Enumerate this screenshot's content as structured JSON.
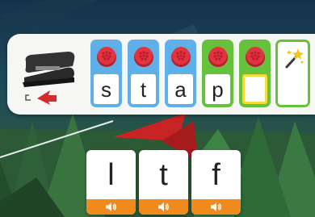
{
  "colors": {
    "tile_blue": "#5fb0e8",
    "tile_green": "#66c23c",
    "cap_red": "#e23340",
    "target_outline": "#f0dc3a",
    "sound_bar": "#f08a1c",
    "panel": "#f6f6f4"
  },
  "picture": {
    "icon": "stapler-icon"
  },
  "word_tiles": [
    {
      "letter": "s",
      "color": "blue",
      "filled": true
    },
    {
      "letter": "t",
      "color": "blue",
      "filled": true
    },
    {
      "letter": "a",
      "color": "blue",
      "filled": true
    },
    {
      "letter": "p",
      "color": "green",
      "filled": true
    },
    {
      "letter": "",
      "color": "green",
      "filled": false
    }
  ],
  "magic_button": {
    "icon": "magic-wand-icon"
  },
  "choices": [
    {
      "letter": "l",
      "sound_icon": "speaker-icon"
    },
    {
      "letter": "t",
      "sound_icon": "speaker-icon"
    },
    {
      "letter": "f",
      "sound_icon": "speaker-icon"
    }
  ]
}
